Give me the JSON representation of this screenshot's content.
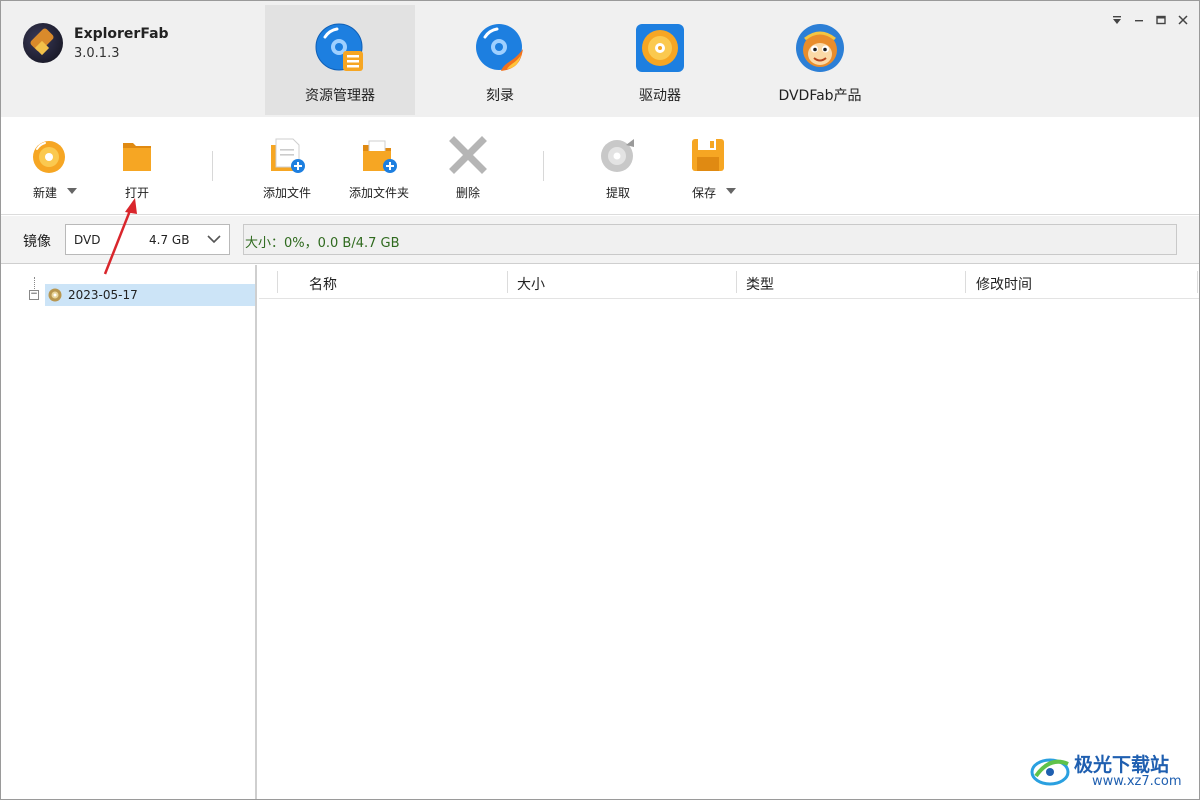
{
  "app": {
    "name": "ExplorerFab",
    "version": "3.0.1.3"
  },
  "main_tabs": [
    {
      "label": "资源管理器",
      "icon": "disc-explorer-icon",
      "active": true
    },
    {
      "label": "刻录",
      "icon": "burn-disc-icon",
      "active": false
    },
    {
      "label": "驱动器",
      "icon": "drive-icon",
      "active": false
    },
    {
      "label": "DVDFab产品",
      "icon": "dvdfab-monkey-icon",
      "active": false
    }
  ],
  "window_controls": [
    "dropdown-icon",
    "minimize-icon",
    "maximize-icon",
    "close-icon"
  ],
  "toolbar": {
    "new_label": "新建",
    "open_label": "打开",
    "add_file_label": "添加文件",
    "add_folder_label": "添加文件夹",
    "delete_label": "删除",
    "extract_label": "提取",
    "save_label": "保存"
  },
  "image_bar": {
    "label": "镜像",
    "disc_type": "DVD",
    "disc_capacity": "4.7 GB",
    "size_text": "大小：0%，0.0 B/4.7 GB",
    "size_fill": 0
  },
  "tree": {
    "root_label": "2023-05-17"
  },
  "file_list": {
    "columns": [
      "名称",
      "大小",
      "类型",
      "修改时间"
    ],
    "rows": []
  },
  "watermark": {
    "title": "极光下载站",
    "url": "www.xz7.com"
  },
  "colors": {
    "accent_orange": "#f39a1c",
    "accent_blue": "#1d7fe0",
    "selection": "#cce4f7",
    "size_text": "#2f6a1e",
    "annotation_arrow": "#d9262c"
  }
}
